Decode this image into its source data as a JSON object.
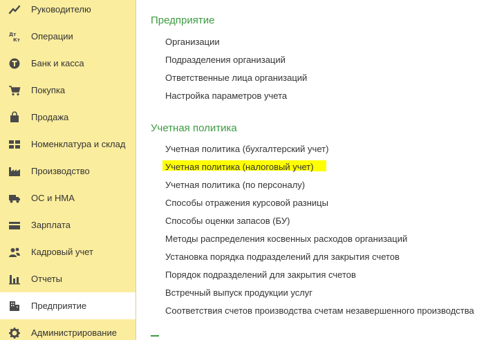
{
  "sidebar": {
    "items": [
      {
        "label": "Руководителю",
        "icon": "trend-chart-icon"
      },
      {
        "label": "Операции",
        "icon": "debit-credit-icon"
      },
      {
        "label": "Банк и касса",
        "icon": "coin-icon"
      },
      {
        "label": "Покупка",
        "icon": "shopping-cart-icon"
      },
      {
        "label": "Продажа",
        "icon": "shopping-bag-icon"
      },
      {
        "label": "Номенклатура и склад",
        "icon": "grid-icon"
      },
      {
        "label": "Производство",
        "icon": "factory-icon"
      },
      {
        "label": "ОС и НМА",
        "icon": "truck-icon"
      },
      {
        "label": "Зарплата",
        "icon": "wallet-icon"
      },
      {
        "label": "Кадровый учет",
        "icon": "people-icon"
      },
      {
        "label": "Отчеты",
        "icon": "bar-chart-icon"
      },
      {
        "label": "Предприятие",
        "icon": "building-icon",
        "active": true
      },
      {
        "label": "Администрирование",
        "icon": "gear-icon"
      }
    ]
  },
  "sections": [
    {
      "title": "Предприятие",
      "links": [
        "Организации",
        "Подразделения организаций",
        "Ответственные лица организаций",
        "Настройка параметров учета"
      ]
    },
    {
      "title": "Учетная политика",
      "links": [
        "Учетная политика (бухгалтерский учет)",
        "Учетная политика (налоговый учет)",
        "Учетная политика (по персоналу)",
        "Способы отражения курсовой разницы",
        "Способы оценки запасов (БУ)",
        "Методы распределения косвенных расходов организаций",
        "Установка порядка подразделений для закрытия счетов",
        "Порядок подразделений для закрытия счетов",
        "Встречный выпуск продукции услуг",
        "Соответствия счетов производства счетам незавершенного производства"
      ]
    }
  ],
  "colors": {
    "sidebar_bg": "#fbed9e",
    "section_title": "#3c9b40",
    "highlight": "#ffff00",
    "text": "#333333",
    "icon": "#4a4a4a"
  }
}
